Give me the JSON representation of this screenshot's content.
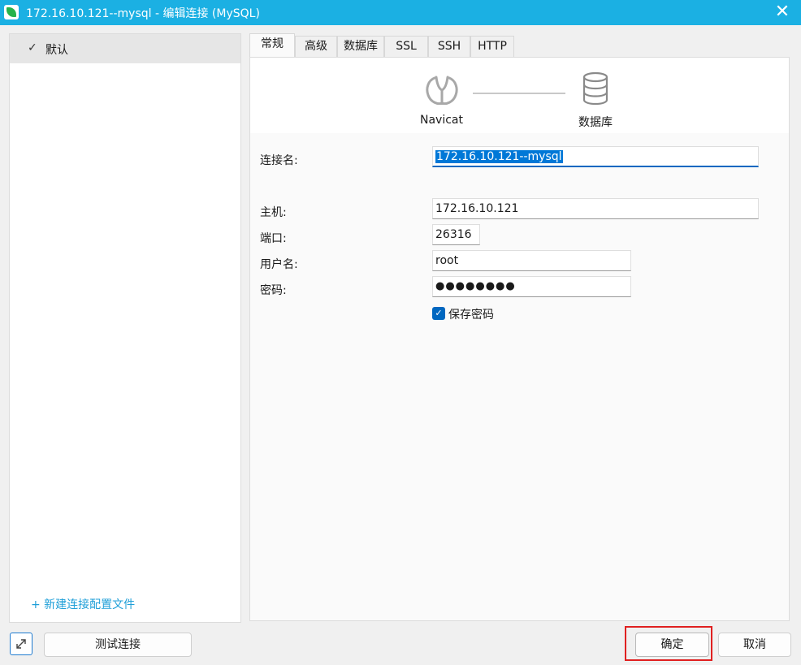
{
  "window": {
    "title": "172.16.10.121--mysql - 编辑连接 (MySQL)",
    "close_glyph": "✕"
  },
  "sidebar": {
    "items": [
      {
        "label": "默认",
        "check": "✓"
      }
    ],
    "new_profile": "+ 新建连接配置文件"
  },
  "tabs": [
    {
      "label": "常规",
      "active": true
    },
    {
      "label": "高级"
    },
    {
      "label": "数据库"
    },
    {
      "label": "SSL"
    },
    {
      "label": "SSH"
    },
    {
      "label": "HTTP"
    }
  ],
  "header": {
    "left_caption": "Navicat",
    "right_caption": "数据库",
    "left_icon": "navicat-logo-icon",
    "right_icon": "database-icon"
  },
  "form": {
    "connection_name": {
      "label": "连接名:",
      "value": "172.16.10.121--mysql"
    },
    "host": {
      "label": "主机:",
      "value": "172.16.10.121"
    },
    "port": {
      "label": "端口:",
      "value": "26316"
    },
    "username": {
      "label": "用户名:",
      "value": "root"
    },
    "password": {
      "label": "密码:",
      "value": "●●●●●●●●"
    },
    "save_password": {
      "label": "保存密码",
      "checked": true
    }
  },
  "footer": {
    "test_button": "测试连接",
    "ok_button": "确定",
    "cancel_button": "取消"
  },
  "colors": {
    "titlebar": "#1bb0e3",
    "accent": "#0067c0",
    "highlight": "#e02020"
  }
}
